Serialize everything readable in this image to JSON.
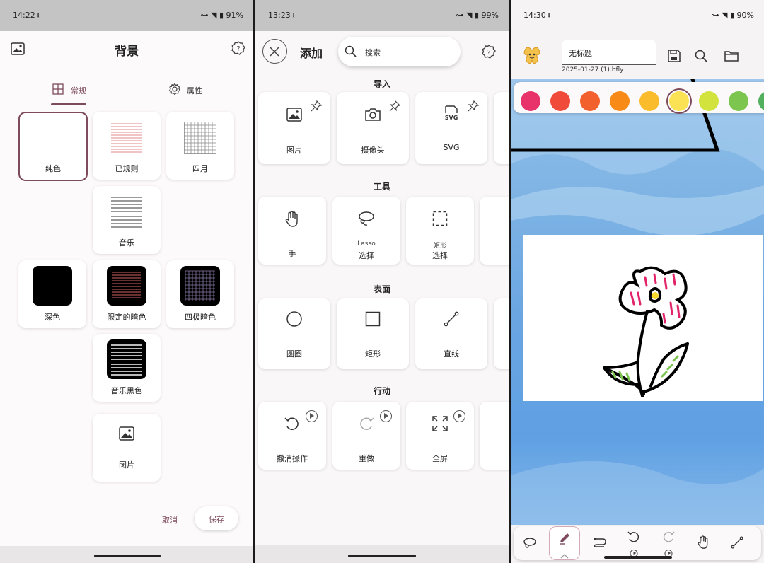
{
  "panel1": {
    "status": {
      "time": "14:22",
      "download": "⭳",
      "right": "⊶ ◥ ▮ 91%"
    },
    "title": "背景",
    "tabs": [
      {
        "label": "常规"
      },
      {
        "label": "属性"
      }
    ],
    "tiles": [
      {
        "label": "纯色"
      },
      {
        "label": "已规则"
      },
      {
        "label": "四月"
      },
      {
        "label": "音乐"
      },
      {
        "label": "深色"
      },
      {
        "label": "限定的暗色"
      },
      {
        "label": "四极暗色"
      },
      {
        "label": "音乐黑色"
      },
      {
        "label": "图片"
      }
    ],
    "cancel_label": "取消",
    "save_label": "保存",
    "accent": "#7d4b5d"
  },
  "panel2": {
    "status": {
      "time": "13:23",
      "download": "⭳",
      "right": "⊶ ◥ ▮ 99%"
    },
    "title": "添加",
    "search_placeholder": "搜索",
    "sections": {
      "import": {
        "title": "导入",
        "items": [
          "图片",
          "摄像头",
          "SVG"
        ],
        "svg_badge": "SVG"
      },
      "tools": {
        "title": "工具",
        "items": [
          {
            "line1": "",
            "line2": "手"
          },
          {
            "line1": "Lasso",
            "line2": "选择"
          },
          {
            "line1": "矩形",
            "line2": "选择"
          }
        ]
      },
      "surface": {
        "title": "表面",
        "items": [
          "圆圈",
          "矩形",
          "直线"
        ]
      },
      "actions": {
        "title": "行动",
        "items": [
          "撤消操作",
          "重做",
          "全屏"
        ]
      }
    }
  },
  "panel3": {
    "status": {
      "time": "14:30",
      "download": "⭳",
      "right": "⊶ ◥ ▮ 90%"
    },
    "doc_title": "无标题",
    "file_name": "2025-01-27 (1).bfly",
    "palette": [
      "#e8336a",
      "#ef4a3a",
      "#f2602e",
      "#f88b18",
      "#fbbc2c",
      "#fbe154",
      "#d3e33e",
      "#7cc650",
      "#52b05e"
    ],
    "selected_color_index": 5
  }
}
